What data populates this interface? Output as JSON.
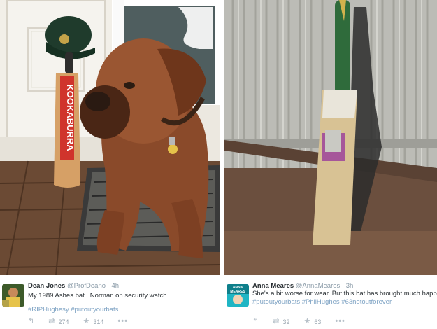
{
  "left_tweet": {
    "name": "Dean Jones",
    "handle": "@ProfDeano",
    "separator": "·",
    "time": "4h",
    "text": "My 1989 Ashes bat.. Norman on security watch",
    "hashtags": "#RIPHughesy #putoutyourbats",
    "retweets": "274",
    "favorites": "314",
    "icons": [
      "reply-icon",
      "retweet-icon",
      "star-icon",
      "more-icon"
    ],
    "image": {
      "bat_brand": "KOOKABURRA",
      "subject": "dog-with-bat-and-cap"
    }
  },
  "right_tweet": {
    "name": "Anna Meares",
    "handle": "@AnnaMeares",
    "separator": "·",
    "time": "3h",
    "text": "She's a bit worse for wear. But this bat has brought much happine",
    "hashtags": "#putoutyourbats #PhilHughes #63notoutforever",
    "retweets": "32",
    "favorites": "63",
    "icons": [
      "reply-icon",
      "retweet-icon",
      "star-icon",
      "more-icon"
    ],
    "avatar_text": "ANNA MEARES",
    "image": {
      "subject": "old-bat-against-fence"
    }
  },
  "colors": {
    "name": "#292f33",
    "meta": "#8899a6",
    "hashtag": "#7ea3c4",
    "action": "#9aa6b0"
  }
}
